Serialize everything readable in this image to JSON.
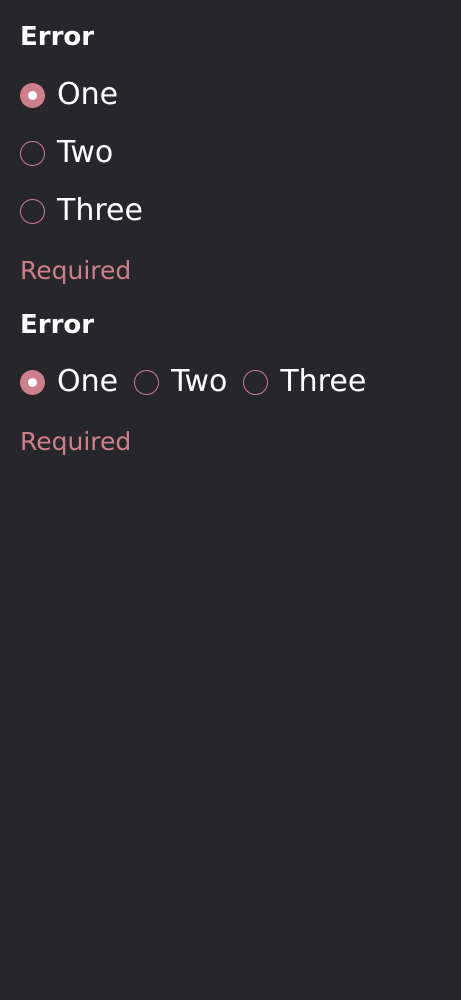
{
  "accent_color": "#ce7f8c",
  "background_color": "#27262b",
  "groups": [
    {
      "label": "Error",
      "orientation": "vertical",
      "options": [
        {
          "label": "One",
          "checked": true
        },
        {
          "label": "Two",
          "checked": false
        },
        {
          "label": "Three",
          "checked": false
        }
      ],
      "helper_text": "Required"
    },
    {
      "label": "Error",
      "orientation": "horizontal",
      "options": [
        {
          "label": "One",
          "checked": true
        },
        {
          "label": "Two",
          "checked": false
        },
        {
          "label": "Three",
          "checked": false
        }
      ],
      "helper_text": "Required"
    }
  ]
}
